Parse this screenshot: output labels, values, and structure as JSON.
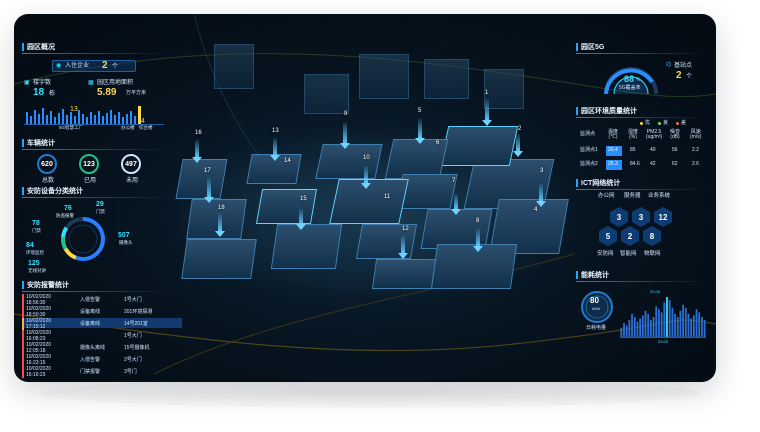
{
  "left": {
    "park_overview": {
      "title": "园区概况",
      "enterprise_label": "入住企业",
      "enterprise_value": "2",
      "enterprise_unit": "个",
      "building_label": "楼宇数",
      "building_value": "18",
      "building_unit": "栋",
      "area_label": "园区用地面积",
      "area_value": "5.89",
      "area_unit": "万平方米",
      "bars_left_label": "13",
      "bars_left_caption": "5G智慧工厂",
      "bars_right_label": "4",
      "bars_right_caption1": "办公楼",
      "bars_right_caption2": "综合楼"
    },
    "vehicle": {
      "title": "车辆统计",
      "items": [
        {
          "value": "620",
          "label": "总数"
        },
        {
          "value": "123",
          "label": "已用"
        },
        {
          "value": "497",
          "label": "未用"
        }
      ]
    },
    "security_devices": {
      "title": "安防设备分类统计",
      "items": [
        {
          "value": "76",
          "label": "防盗报警"
        },
        {
          "value": "29",
          "label": "门禁"
        },
        {
          "value": "78",
          "label": "门禁"
        },
        {
          "value": "84",
          "label": "环境监控"
        },
        {
          "value": "125",
          "label": "无线对讲"
        },
        {
          "value": "507",
          "label": "摄像头"
        }
      ]
    },
    "alarms": {
      "title": "安防报警统计",
      "rows": [
        {
          "date": "10/02/2020",
          "time": "18:56:30",
          "type": "入侵告警",
          "place": "1号大门"
        },
        {
          "date": "10/02/2020",
          "time": "18:50:30",
          "type": "设备离线",
          "place": "201环境探测"
        },
        {
          "date": "10/02/2020",
          "time": "17:15:12",
          "type": "设备离线",
          "place": "14号201室"
        },
        {
          "date": "10/02/2020",
          "time": "16:08:23",
          "type": "",
          "place": "1号大门"
        },
        {
          "date": "10/02/2020",
          "time": "12:05:18",
          "type": "摄像头离线",
          "place": "15号摄像机"
        },
        {
          "date": "10/02/2020",
          "time": "16:23:15",
          "type": "入侵告警",
          "place": "2号大门"
        },
        {
          "date": "10/02/2020",
          "time": "16:16:23",
          "type": "门禁报警",
          "place": "3号门"
        }
      ]
    }
  },
  "right": {
    "g5": {
      "title": "园区5G",
      "coverage_value": "88",
      "coverage_unit": "%",
      "coverage_label": "5G覆盖率",
      "station_label": "基站点",
      "station_value": "2",
      "station_unit": "个"
    },
    "env": {
      "title": "园区环境质量统计",
      "legend": [
        "优",
        "良",
        "差"
      ],
      "headers": [
        "监测点",
        "温度\n(℃)",
        "湿度\n(%)",
        "PM2.5\n(ug/m³)",
        "噪音\n(dB)",
        "风速\n(m/s)"
      ],
      "rows": [
        {
          "name": "监测点1",
          "values": [
            "20.4",
            "85",
            "40",
            "56",
            "2.2"
          ]
        },
        {
          "name": "监测点2",
          "values": [
            "25.3",
            "84.6",
            "42",
            "62",
            "2.6"
          ]
        }
      ]
    },
    "ict": {
      "title": "ICT网络统计",
      "col_labels": [
        "办公网",
        "服务器",
        "业务系统"
      ],
      "top_values": [
        "3",
        "3",
        "12"
      ],
      "bottom_values": [
        "5",
        "2",
        "8"
      ],
      "bottom_labels": [
        "安防网",
        "智能网",
        "物联网"
      ]
    },
    "energy": {
      "title": "能耗统计",
      "gauge_value": "80",
      "gauge_unit": "kWh",
      "gauge_label": "日耗电量",
      "peak_label": "20.00",
      "x_label": "20:00"
    }
  },
  "chart_data": {
    "type": "bar",
    "values": [
      12,
      18,
      15,
      22,
      30,
      26,
      20,
      24,
      28,
      34,
      30,
      22,
      26,
      40,
      36,
      32,
      45,
      52,
      48,
      38,
      30,
      26,
      34,
      42,
      38,
      30,
      24,
      28,
      36,
      32,
      26,
      22
    ],
    "highlight_index": 17,
    "title": "",
    "xlabel": "",
    "ylabel": ""
  },
  "map": {
    "markers": [
      "1",
      "2",
      "3",
      "4",
      "5",
      "6",
      "7",
      "8",
      "9",
      "10",
      "11",
      "12",
      "13",
      "14",
      "15",
      "16",
      "17",
      "18"
    ]
  },
  "colors": {
    "accent": "#1ea7ff",
    "cyan": "#35e0ff",
    "yellow": "#ffd84a",
    "good": "#ffd84a",
    "medium": "#7ee04a",
    "bad": "#ff6a3d"
  }
}
